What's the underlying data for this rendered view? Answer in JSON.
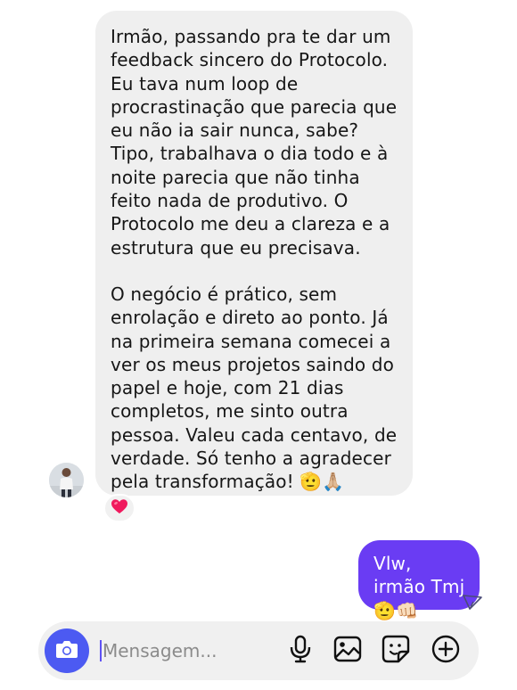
{
  "conversation": {
    "incoming": {
      "paragraphs": [
        "Irmão, passando pra te dar um feedback sincero do Protocolo. Eu tava num loop de procrastinação que parecia que eu não ia sair nunca, sabe? Tipo, trabalhava o dia todo e à noite parecia que não tinha feito nada de produtivo. O Protocolo me deu a clareza e a estrutura que eu precisava.",
        "O negócio é prático, sem enrolação e direto ao ponto. Já na primeira semana comecei a ver os meus projetos saindo do papel e hoje, com 21 dias completos, me sinto outra pessoa. Valeu cada centavo, de verdade. Só tenho a agradecer pela transformação!"
      ],
      "emojis": "🫡🙏🏼",
      "reaction": "❤️",
      "avatar_icon": "profile-photo"
    },
    "outgoing": {
      "text": "Vlw, irmão Tmj",
      "emojis": "🫡👊🏻",
      "status_icon": "seen-check-icon"
    }
  },
  "composer": {
    "placeholder": "Mensagem...",
    "camera_icon": "camera-icon",
    "tools": [
      "microphone-icon",
      "gallery-icon",
      "sticker-icon",
      "plus-icon"
    ]
  },
  "colors": {
    "incoming_bubble": "#efefef",
    "outgoing_bubble": "#6a3cf3",
    "camera_button": "#4c5af2",
    "composer_bg": "#f0f0f0",
    "text": "#161616"
  }
}
